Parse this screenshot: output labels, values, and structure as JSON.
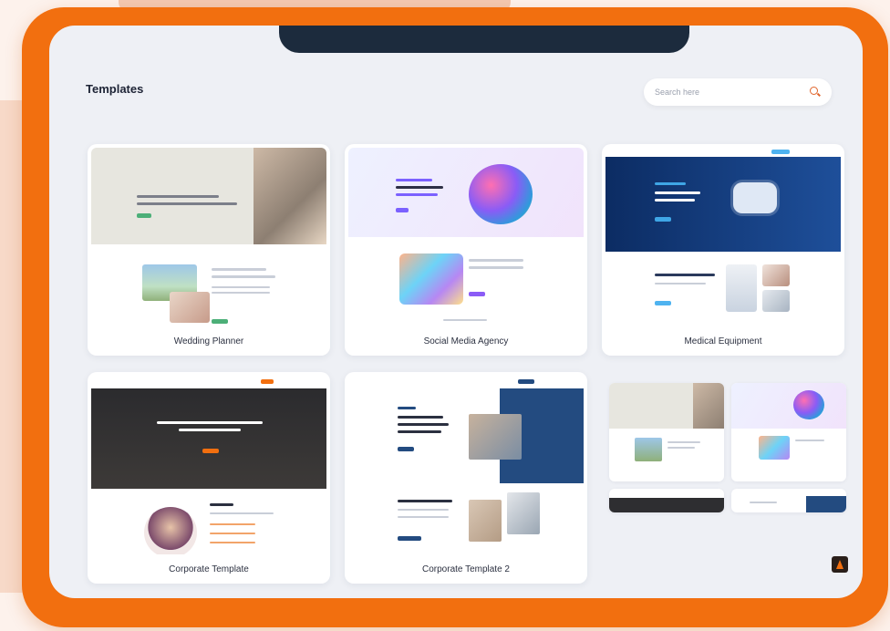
{
  "header": {
    "title": "Templates",
    "search_placeholder": "Search here"
  },
  "templates": [
    {
      "name": "Wedding Planner"
    },
    {
      "name": "Social Media Agency"
    },
    {
      "name": "Medical Equipment"
    },
    {
      "name": "Corporate Template"
    },
    {
      "name": "Corporate Template 2"
    }
  ],
  "colors": {
    "frame": "#f26f0f",
    "screen": "#eef0f5",
    "accent": "#e0642a"
  },
  "icons": {
    "search": "search-icon",
    "brand": "brand-logo-icon"
  }
}
